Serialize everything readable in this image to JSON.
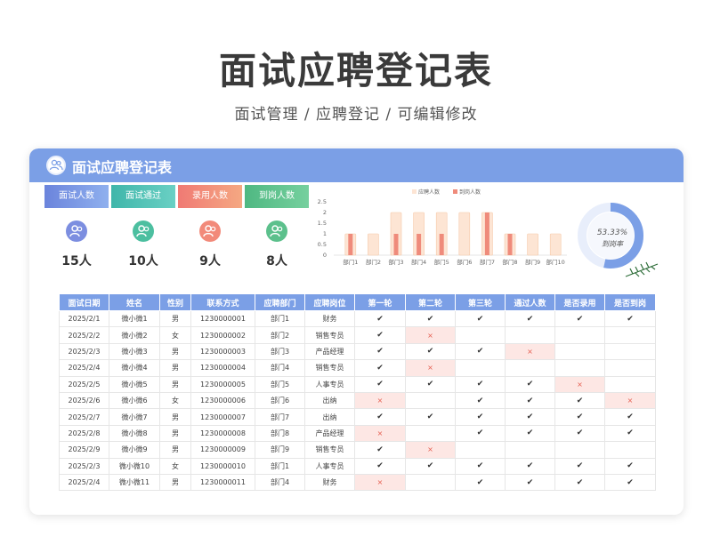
{
  "title": "面试应聘登记表",
  "subtitle": "面试管理 /  应聘登记  /  可编辑修改",
  "card": {
    "title": "面试应聘登记表"
  },
  "stats": [
    {
      "label": "面试人数",
      "value": "15人",
      "color": "#7c8ee0"
    },
    {
      "label": "面试通过",
      "value": "10人",
      "color": "#4cbfb4"
    },
    {
      "label": "录用人数",
      "value": "9人",
      "color": "#f28a7a"
    },
    {
      "label": "到岗人数",
      "value": "8人",
      "color": "#5cc08c"
    }
  ],
  "donut": {
    "value_label": "53.33%",
    "caption": "到岗率",
    "percent": 53.33,
    "color": "#7b9fe6"
  },
  "chart_data": {
    "type": "bar",
    "categories": [
      "部门1",
      "部门2",
      "部门3",
      "部门4",
      "部门5",
      "部门6",
      "部门7",
      "部门8",
      "部门9",
      "部门10"
    ],
    "series": [
      {
        "name": "应聘人数",
        "values": [
          1,
          1,
          2,
          2,
          2,
          2,
          2,
          1,
          1,
          1
        ],
        "color": "#fde5d4"
      },
      {
        "name": "到岗人数",
        "values": [
          1,
          0,
          1,
          1,
          1,
          0,
          2,
          1,
          0,
          0
        ],
        "color": "#ef8b7b"
      }
    ],
    "yticks": [
      "0",
      "0.5",
      "1",
      "1.5",
      "2",
      "2.5"
    ],
    "ylim": [
      0,
      2.5
    ],
    "legend_position": "top"
  },
  "table": {
    "headers": [
      "面试日期",
      "姓名",
      "性别",
      "联系方式",
      "应聘部门",
      "应聘岗位",
      "第一轮",
      "第二轮",
      "第三轮",
      "通过人数",
      "是否录用",
      "是否到岗"
    ],
    "rows": [
      [
        "2025/2/1",
        "微小微1",
        "男",
        "1230000001",
        "部门1",
        "财务",
        "✔",
        "✔",
        "✔",
        "✔",
        "✔",
        "✔"
      ],
      [
        "2025/2/2",
        "微小微2",
        "女",
        "1230000002",
        "部门2",
        "销售专员",
        "✔",
        "×",
        "",
        "",
        "",
        ""
      ],
      [
        "2025/2/3",
        "微小微3",
        "男",
        "1230000003",
        "部门3",
        "产品经理",
        "✔",
        "✔",
        "✔",
        "×",
        "",
        ""
      ],
      [
        "2025/2/4",
        "微小微4",
        "男",
        "1230000004",
        "部门4",
        "销售专员",
        "✔",
        "×",
        "",
        "",
        "",
        ""
      ],
      [
        "2025/2/5",
        "微小微5",
        "男",
        "1230000005",
        "部门5",
        "人事专员",
        "✔",
        "✔",
        "✔",
        "✔",
        "×",
        ""
      ],
      [
        "2025/2/6",
        "微小微6",
        "女",
        "1230000006",
        "部门6",
        "出纳",
        "×",
        "",
        "✔",
        "✔",
        "✔",
        "×"
      ],
      [
        "2025/2/7",
        "微小微7",
        "男",
        "1230000007",
        "部门7",
        "出纳",
        "✔",
        "✔",
        "✔",
        "✔",
        "✔",
        "✔"
      ],
      [
        "2025/2/8",
        "微小微8",
        "男",
        "1230000008",
        "部门8",
        "产品经理",
        "×",
        "",
        "✔",
        "✔",
        "✔",
        "✔"
      ],
      [
        "2025/2/9",
        "微小微9",
        "男",
        "1230000009",
        "部门9",
        "销售专员",
        "✔",
        "×",
        "",
        "",
        "",
        ""
      ],
      [
        "2025/2/3",
        "微小微10",
        "女",
        "1230000010",
        "部门1",
        "人事专员",
        "✔",
        "✔",
        "✔",
        "✔",
        "✔",
        "✔"
      ],
      [
        "2025/2/4",
        "微小微11",
        "男",
        "1230000011",
        "部门4",
        "财务",
        "×",
        "",
        "✔",
        "✔",
        "✔",
        "✔"
      ]
    ]
  }
}
